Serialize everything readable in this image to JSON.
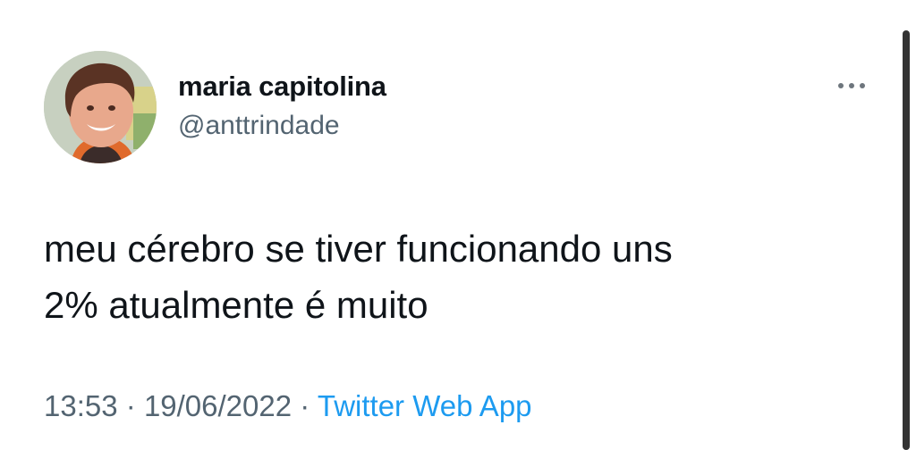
{
  "tweet": {
    "author_name": "maria capitolina",
    "handle": "@anttrindade",
    "avatar_icon": "profile-photo",
    "more_icon": "more-horizontal-icon",
    "text_lines": [
      "meu cérebro se tiver funcionando uns",
      "2% atualmente é muito"
    ],
    "time": "13:53",
    "separator": "·",
    "date": "19/06/2022",
    "source": "Twitter Web App"
  },
  "colors": {
    "text_primary": "#0f1419",
    "text_secondary": "#536471",
    "link": "#1d9bf0"
  }
}
